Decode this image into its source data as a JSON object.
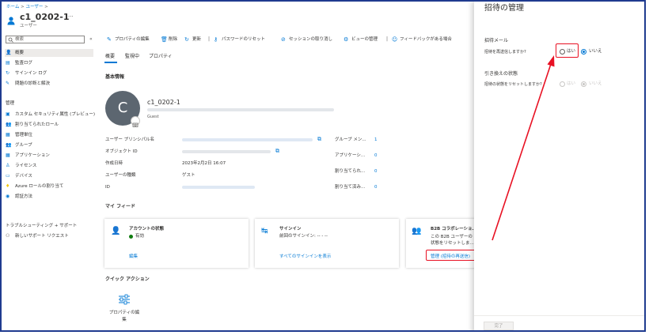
{
  "breadcrumb": {
    "home": "ホーム",
    "sep1": ">",
    "users": "ユーザー",
    "sep2": ">"
  },
  "header": {
    "title": "c1_0202-1",
    "more": "···",
    "subtitle": "ユーザー"
  },
  "search": {
    "placeholder": "検索",
    "collapse": "«"
  },
  "sidebar": {
    "items": [
      {
        "icon": "person-icon",
        "label": "概要"
      },
      {
        "icon": "audit-log-icon",
        "label": "監査ログ"
      },
      {
        "icon": "signin-log-icon",
        "label": "サインイン ログ"
      },
      {
        "icon": "wrench-icon",
        "label": "問題の診断と解決"
      }
    ],
    "manage_heading": "管理",
    "manage_items": [
      {
        "icon": "security-attributes-icon",
        "label": "カスタム セキュリティ属性 (プレビュー)"
      },
      {
        "icon": "assigned-roles-icon",
        "label": "割り当てられたロール"
      },
      {
        "icon": "admin-units-icon",
        "label": "管理単位"
      },
      {
        "icon": "groups-icon",
        "label": "グループ"
      },
      {
        "icon": "applications-icon",
        "label": "アプリケーション"
      },
      {
        "icon": "licenses-icon",
        "label": "ライセンス"
      },
      {
        "icon": "devices-icon",
        "label": "デバイス"
      },
      {
        "icon": "azure-role-icon",
        "label": "Azure ロールの割り当て"
      },
      {
        "icon": "auth-methods-icon",
        "label": "認証方法"
      }
    ],
    "support_heading": "トラブルシューティング + サポート",
    "support_items": [
      {
        "icon": "support-request-icon",
        "label": "新しいサポート リクエスト"
      }
    ]
  },
  "toolbar": {
    "edit": "プロパティの編集",
    "delete": "削除",
    "refresh": "更新",
    "reset_password": "パスワードのリセット",
    "revoke": "セッションの取り消し",
    "views": "ビューの管理",
    "feedback": "フィードバックがある場合"
  },
  "tabs": {
    "overview": "概要",
    "monitoring": "監視中",
    "properties": "プロパティ"
  },
  "basic": {
    "heading": "基本情報",
    "avatar_letter": "C",
    "name": "c1_0202-1",
    "user_type_badge": "Guest",
    "upn_label": "ユーザー プリンシパル名",
    "object_id_label": "オブジェクト ID",
    "created_label": "作成日時",
    "created_value": "2023年2月2日 16:07",
    "user_type_label": "ユーザーの種類",
    "user_type_value": "ゲスト",
    "id_label": "ID",
    "group_member_label": "グループ メン...",
    "group_member_value": "1",
    "applications_label": "アプリケーシ...",
    "applications_value": "0",
    "assigned_roles_label": "割り当てられ...",
    "assigned_roles_value": "0",
    "assigned_licenses_label": "割り当て済み...",
    "assigned_licenses_value": "0"
  },
  "feed": {
    "heading": "マイ フィード",
    "account": {
      "title": "アカウントの状態",
      "status": "有効",
      "link": "編集"
    },
    "signin": {
      "title": "サインイン",
      "sub": "前回のサインイン: -- - --",
      "link": "すべてのサインインを表示"
    },
    "b2b": {
      "title": "B2B コラボレーショ...",
      "line1": "この B2B ユーザーの",
      "line2": "状態をリセットしま...",
      "link": "管理 (招待の再送信)"
    }
  },
  "quick": {
    "heading": "クイック アクション",
    "edit_label_1": "プロパティの編",
    "edit_label_2": "集"
  },
  "panel": {
    "title": "招待の管理",
    "invite_mail_heading": "招待メール",
    "resend_question": "招待を再送信しますか?",
    "yes": "はい",
    "no": "いいえ",
    "redeem_heading": "引き換えの状態",
    "reset_question": "招待の状態をリセットしますか?",
    "done": "完了"
  },
  "colors": {
    "accent": "#0078d4",
    "highlight": "#e81123",
    "arrow": "#e81123",
    "frame": "#1f3b8f",
    "avatar": "#5c6670"
  }
}
